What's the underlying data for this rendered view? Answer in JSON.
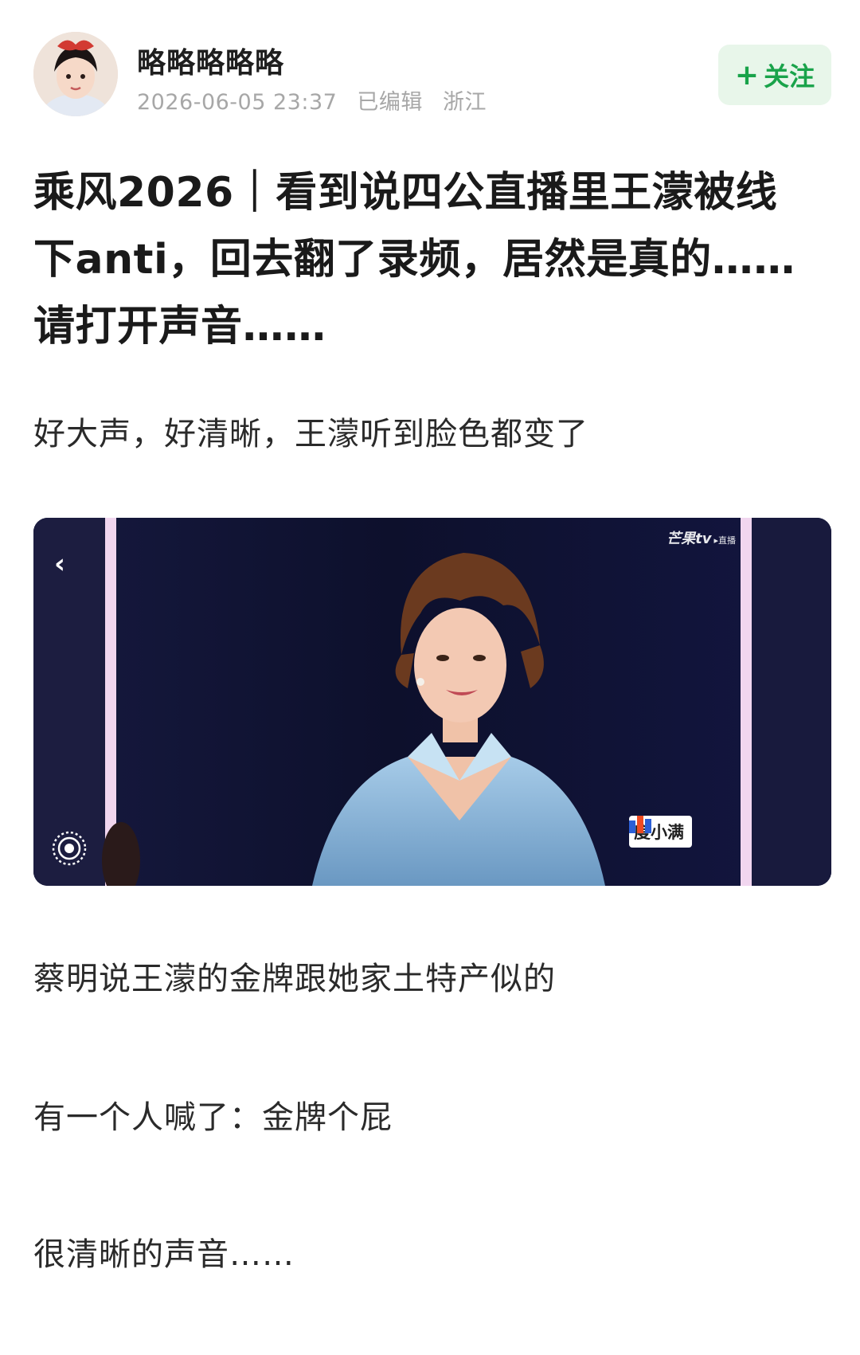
{
  "author": {
    "name": "略略略略略",
    "timestamp": "2026-06-05 23:37",
    "edited": "已编辑",
    "location": "浙江"
  },
  "follow": {
    "label": "关注"
  },
  "post": {
    "title": "乘风2026｜看到说四公直播里王濛被线下anti，回去翻了录频，居然是真的……请打开声音……",
    "paragraphs": [
      "好大声，好清晰，王濛听到脸色都变了",
      "蔡明说王濛的金牌跟她家土特产似的",
      "有一个人喊了：金牌个屁",
      "很清晰的声音……"
    ]
  },
  "media": {
    "watermark": "芒果tv",
    "watermark_sub": "▸直播",
    "sponsor": "度小满"
  },
  "colors": {
    "follow_bg": "#e8f6ea",
    "follow_text": "#19a34a",
    "meta_text": "#a7a7a7"
  }
}
